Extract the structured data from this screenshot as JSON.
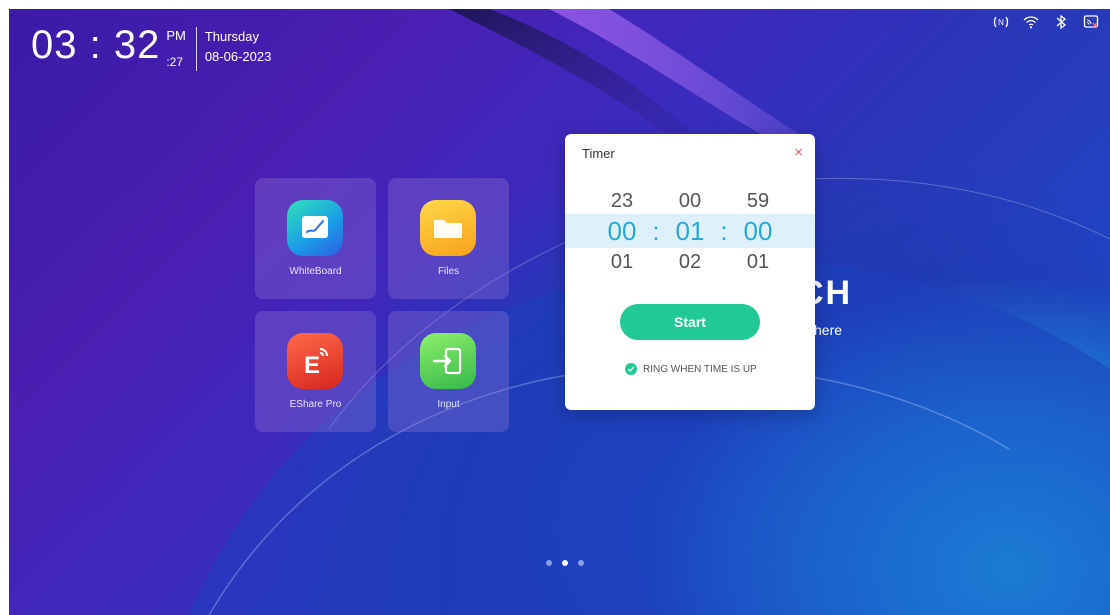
{
  "clock": {
    "time": "03 : 32",
    "ampm": "PM",
    "seconds": ":27",
    "day": "Thursday",
    "date": "08-06-2023"
  },
  "status_bar": {
    "icons": [
      "nfc-icon",
      "wifi-icon",
      "bluetooth-icon",
      "screen-cast-off-icon"
    ]
  },
  "apps": [
    {
      "label": "WhiteBoard",
      "icon": "whiteboard-icon"
    },
    {
      "label": "Files",
      "icon": "folder-icon"
    },
    {
      "label": "EShare Pro",
      "icon": "eshare-icon"
    },
    {
      "label": "Input",
      "icon": "input-icon"
    }
  ],
  "background_widget": {
    "title_fragment": "CH",
    "subtitle_fragment": "here"
  },
  "timer": {
    "title": "Timer",
    "close": "×",
    "above": [
      "23",
      "00",
      "59"
    ],
    "selected": [
      "00",
      "01",
      "00"
    ],
    "below": [
      "01",
      "02",
      "01"
    ],
    "separator": ":",
    "start_label": "Start",
    "ring_label": "RING WHEN TIME IS UP",
    "accent_color": "#21c995",
    "selected_text_color": "#2aa8d8"
  },
  "page_indicator": {
    "count": 3,
    "active_index": 1
  }
}
